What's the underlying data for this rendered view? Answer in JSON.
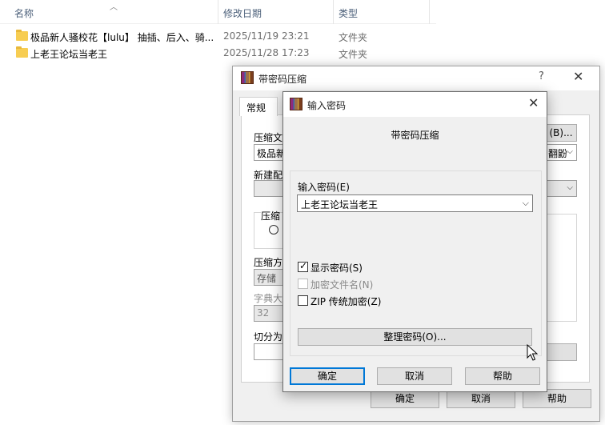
{
  "explorer": {
    "columns": {
      "name": "名称",
      "date": "修改日期",
      "type": "类型"
    },
    "files": [
      {
        "name": "极品新人骚校花【lulu】 抽插、后入、骑...",
        "date": "2025/11/19 23:21",
        "type": "文件夹"
      },
      {
        "name": "上老王论坛当老王",
        "date": "2025/11/28 17:23",
        "type": "文件夹"
      }
    ]
  },
  "back_dialog": {
    "title": "带密码压缩",
    "help": "?",
    "close": "✕",
    "tab": "常规",
    "labels": {
      "archive_name": "压缩文",
      "archive_value": "极品新",
      "browse": "(B)...",
      "new_profile": "新建配",
      "format_group": "压缩",
      "method": "压缩方",
      "method_value": "存储",
      "dict": "字典大",
      "dict_value": "32",
      "split": "切分为",
      "update_value": "翻鼢"
    },
    "buttons": {
      "ok": "确定",
      "cancel": "取消",
      "help": "帮助"
    }
  },
  "front_dialog": {
    "title": "输入密码",
    "header": "带密码压缩",
    "password_label": "输入密码(E)",
    "password_value": "上老王论坛当老王",
    "show_password": {
      "label": "显示密码(S)",
      "checked": true
    },
    "encrypt_names": {
      "label": "加密文件名(N)",
      "checked": false,
      "enabled": false
    },
    "zip_legacy": {
      "label": "ZIP 传统加密(Z)",
      "checked": false
    },
    "organize_button": "整理密码(O)...",
    "buttons": {
      "ok": "确定",
      "cancel": "取消",
      "help": "帮助"
    },
    "close": "✕"
  },
  "icons": {
    "folder": "folder-icon",
    "app": "winrar-icon",
    "close": "close-icon",
    "dropdown": "chevron-down-icon",
    "cursor": "mouse-cursor-icon"
  }
}
